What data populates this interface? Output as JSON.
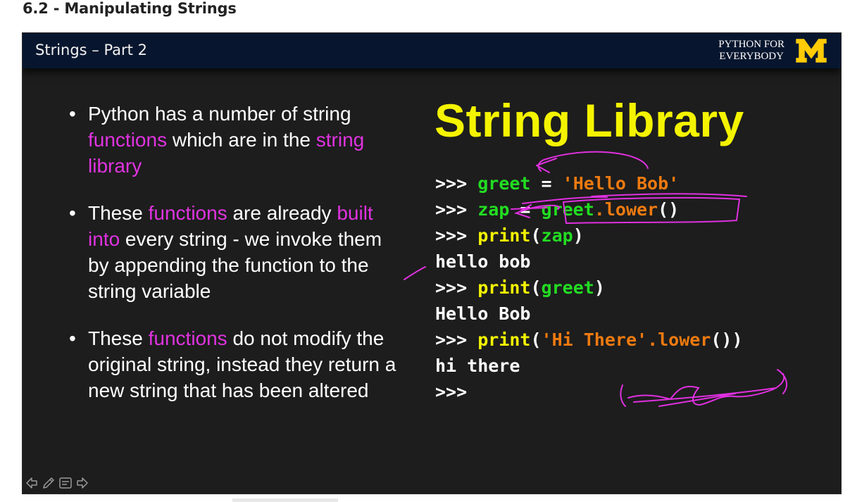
{
  "page": {
    "heading": "6.2 - Manipulating Strings"
  },
  "slide": {
    "header_title": "Strings – Part 2",
    "brand_line1": "PYTHON FOR",
    "brand_line2": "EVERYBODY",
    "logo_text": "M",
    "title": "String Library",
    "bullets": [
      [
        {
          "t": "Python has a number of string ",
          "h": false
        },
        {
          "t": "functions",
          "h": true
        },
        {
          "t": " which are in the ",
          "h": false
        },
        {
          "t": "string library",
          "h": true
        }
      ],
      [
        {
          "t": "These ",
          "h": false
        },
        {
          "t": "functions",
          "h": true
        },
        {
          "t": " are already ",
          "h": false
        },
        {
          "t": "built into",
          "h": true
        },
        {
          "t": " every string - we invoke them by appending the function to the string variable",
          "h": false
        }
      ],
      [
        {
          "t": "These ",
          "h": false
        },
        {
          "t": "functions",
          "h": true
        },
        {
          "t": " do not modify the original string, instead they return a new string that has been altered",
          "h": false
        }
      ]
    ],
    "code_lines": [
      [
        {
          "t": ">>> ",
          "c": "w"
        },
        {
          "t": "greet",
          "c": "g"
        },
        {
          "t": " = ",
          "c": "w"
        },
        {
          "t": "'Hello Bob'",
          "c": "o"
        }
      ],
      [
        {
          "t": ">>> ",
          "c": "w"
        },
        {
          "t": "zap",
          "c": "g"
        },
        {
          "t": " = ",
          "c": "w"
        },
        {
          "t": "greet",
          "c": "g"
        },
        {
          "t": ".lower",
          "c": "o"
        },
        {
          "t": "()",
          "c": "w"
        }
      ],
      [
        {
          "t": ">>> ",
          "c": "w"
        },
        {
          "t": "print",
          "c": "y"
        },
        {
          "t": "(",
          "c": "w"
        },
        {
          "t": "zap",
          "c": "g"
        },
        {
          "t": ")",
          "c": "w"
        }
      ],
      [
        {
          "t": "hello bob",
          "c": "w"
        }
      ],
      [
        {
          "t": ">>> ",
          "c": "w"
        },
        {
          "t": "print",
          "c": "y"
        },
        {
          "t": "(",
          "c": "w"
        },
        {
          "t": "greet",
          "c": "g"
        },
        {
          "t": ")",
          "c": "w"
        }
      ],
      [
        {
          "t": "Hello Bob",
          "c": "w"
        }
      ],
      [
        {
          "t": ">>> ",
          "c": "w"
        },
        {
          "t": "print",
          "c": "y"
        },
        {
          "t": "(",
          "c": "w"
        },
        {
          "t": "'Hi There'",
          "c": "o"
        },
        {
          "t": ".lower",
          "c": "o"
        },
        {
          "t": "())",
          "c": "w"
        }
      ],
      [
        {
          "t": "hi there",
          "c": "w"
        }
      ],
      [
        {
          "t": ">>>",
          "c": "w"
        }
      ]
    ],
    "controls": [
      "prev-icon",
      "pen-icon",
      "notes-icon",
      "next-icon"
    ],
    "colors": {
      "highlight": "#e033e0",
      "title": "#f4f400",
      "variable": "#22dd22",
      "keyword": "#f4f400",
      "string": "#ee7a10",
      "annotation": "#e030e0",
      "logo": "#ffcb05"
    }
  }
}
